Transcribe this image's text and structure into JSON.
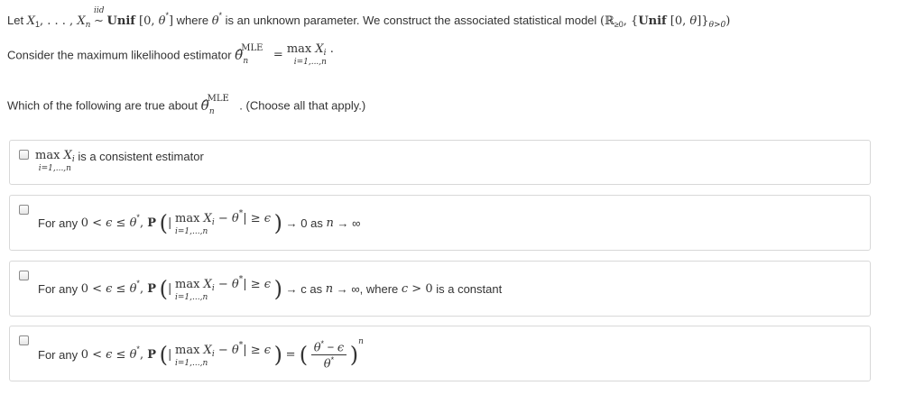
{
  "question": {
    "intro_prefix": "Let",
    "intro_vars": "X",
    "intro_dist": "Unif",
    "intro_param": "θ*",
    "intro_mid": "where",
    "intro_text": "is an unknown parameter. We construct the associated statistical model",
    "iid_label": "iid",
    "mle_prefix": "Consider the maximum likelihood estimator",
    "mle_label": "MLE",
    "max_label": "max",
    "max_index": "i=1,...,n",
    "which_prefix": "Which of the following are true about",
    "which_suffix": ". (Choose all that apply.)"
  },
  "options": [
    {
      "text": "is a consistent estimator"
    },
    {
      "prefix": "For any",
      "suffix": "→ 0 as",
      "tail": "→ ∞"
    },
    {
      "prefix": "For any",
      "suffix": "→ c as",
      "tail": "→ ∞, where",
      "tail2": "is a constant"
    },
    {
      "prefix": "For any"
    }
  ]
}
